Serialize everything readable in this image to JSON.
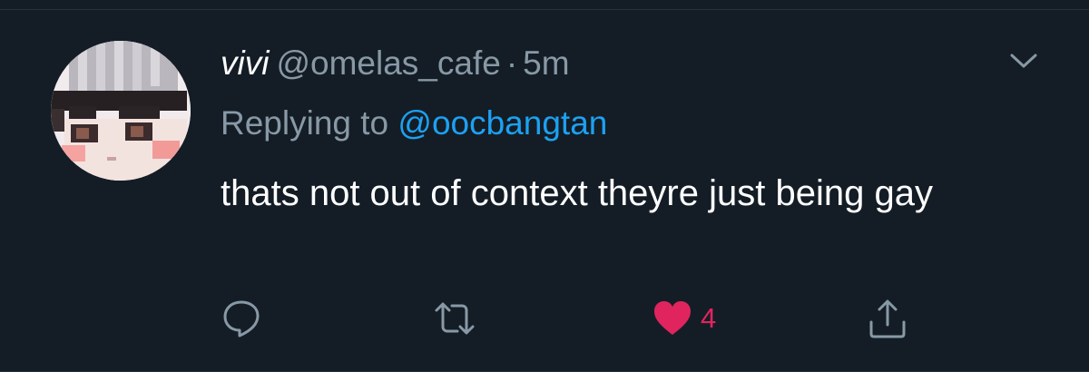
{
  "tweet": {
    "display_name": "vivi",
    "handle": "@omelas_cafe",
    "separator": "·",
    "timestamp": "5m",
    "reply_prefix": "Replying to",
    "reply_to": "@oocbangtan",
    "text": "thats not out of context theyre just being gay",
    "like_count": "4"
  },
  "icons": {
    "menu": "chevron-down-icon",
    "reply": "speech-bubble-icon",
    "retweet": "retweet-icon",
    "like": "heart-icon",
    "share": "share-upload-icon"
  },
  "colors": {
    "background": "#141d26",
    "text_primary": "#ffffff",
    "text_secondary": "#8899a6",
    "link": "#1da1f2",
    "liked": "#e0245e"
  }
}
